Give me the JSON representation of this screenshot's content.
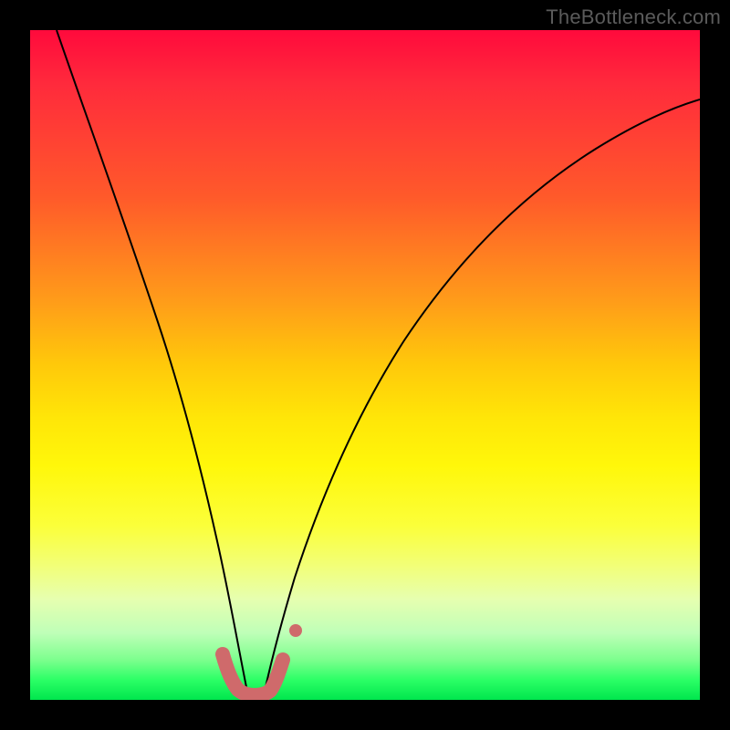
{
  "watermark": "TheBottleneck.com",
  "chart_data": {
    "type": "line",
    "title": "",
    "xlabel": "",
    "ylabel": "",
    "xlim": [
      0,
      100
    ],
    "ylim": [
      0,
      100
    ],
    "grid": false,
    "legend": false,
    "background": "rainbow-vertical-red-to-green",
    "series": [
      {
        "name": "bottleneck-curve",
        "style": "thin-black",
        "x": [
          4,
          8,
          12,
          16,
          20,
          24,
          26,
          28,
          30,
          31,
          32,
          33,
          34,
          36,
          38,
          40,
          42,
          46,
          52,
          60,
          70,
          80,
          90,
          100
        ],
        "y": [
          100,
          88,
          74,
          62,
          50,
          34,
          26,
          18,
          8,
          4,
          1.5,
          1.2,
          1.5,
          4,
          8,
          14,
          20,
          30,
          42,
          54,
          65,
          74,
          80,
          84
        ]
      },
      {
        "name": "highlight-segment",
        "style": "thick-salmon-round",
        "x": [
          28.5,
          29.3,
          30.2,
          31.0,
          32.0,
          33.0,
          33.8,
          34.7,
          35.6,
          36.3
        ],
        "y": [
          7.0,
          4.0,
          2.2,
          1.4,
          1.2,
          1.2,
          1.5,
          2.4,
          4.2,
          6.5
        ]
      },
      {
        "name": "outlier-point",
        "style": "salmon-dot",
        "x": [
          38.2
        ],
        "y": [
          10.8
        ]
      }
    ],
    "colors": {
      "curve": "#000000",
      "highlight": "#cf6a6b",
      "gradient_top": "#ff0a3c",
      "gradient_bottom": "#00e64d"
    }
  }
}
